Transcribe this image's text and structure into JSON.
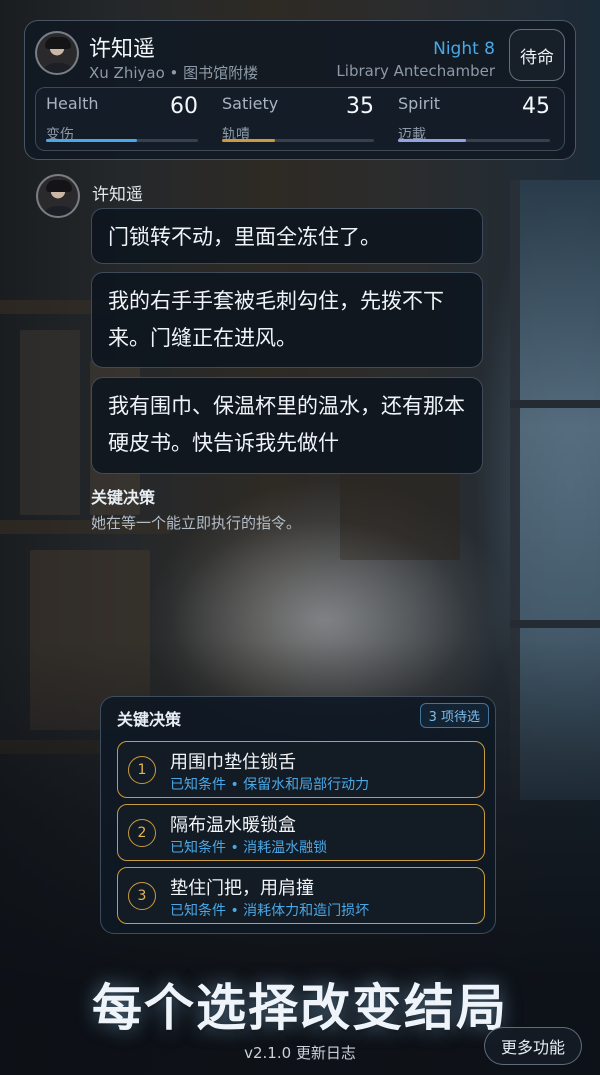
{
  "header": {
    "name": "许知遥",
    "subtitle": "Xu Zhiyao • 图书馆附楼",
    "night": "Night 8",
    "location": "Library Antechamber",
    "standby_label": "待命"
  },
  "stats": [
    {
      "name": "Health",
      "value": "60",
      "cn": "变伤",
      "fill": 0.6,
      "color": "#4aa8e6"
    },
    {
      "name": "Satiety",
      "value": "35",
      "cn": "轨嘖",
      "fill": 0.35,
      "color": "#c99a3e"
    },
    {
      "name": "Spirit",
      "value": "45",
      "cn": "迈載",
      "fill": 0.45,
      "color": "#8fa4e0"
    }
  ],
  "chat": {
    "speaker": "许知遥",
    "messages": [
      "门锁转不动，里面全冻住了。",
      "我的右手手套被毛刺勾住，先拨不下来。门缝正在进风。",
      "我有围巾、保温杯里的温水，还有那本硬皮书。快告诉我先做什"
    ],
    "decision_title": "关键决策",
    "decision_subtitle": "她在等一个能立即执行的指令。"
  },
  "choices_panel": {
    "title": "关键决策",
    "badge": "3 项待选",
    "options": [
      {
        "num": "1",
        "label": "用围巾垫住锁舌",
        "meta": "已知条件 • 保留水和局部行动力"
      },
      {
        "num": "2",
        "label": "隔布温水暖锁盒",
        "meta": "已知条件 • 消耗温水融锁"
      },
      {
        "num": "3",
        "label": "垫住门把，用肩撞",
        "meta": "已知条件 • 消耗体力和造门损坏"
      }
    ]
  },
  "footer": {
    "slogan": "每个选择改变结局",
    "version": "v2.1.0 更新日志",
    "more_label": "更多功能"
  }
}
